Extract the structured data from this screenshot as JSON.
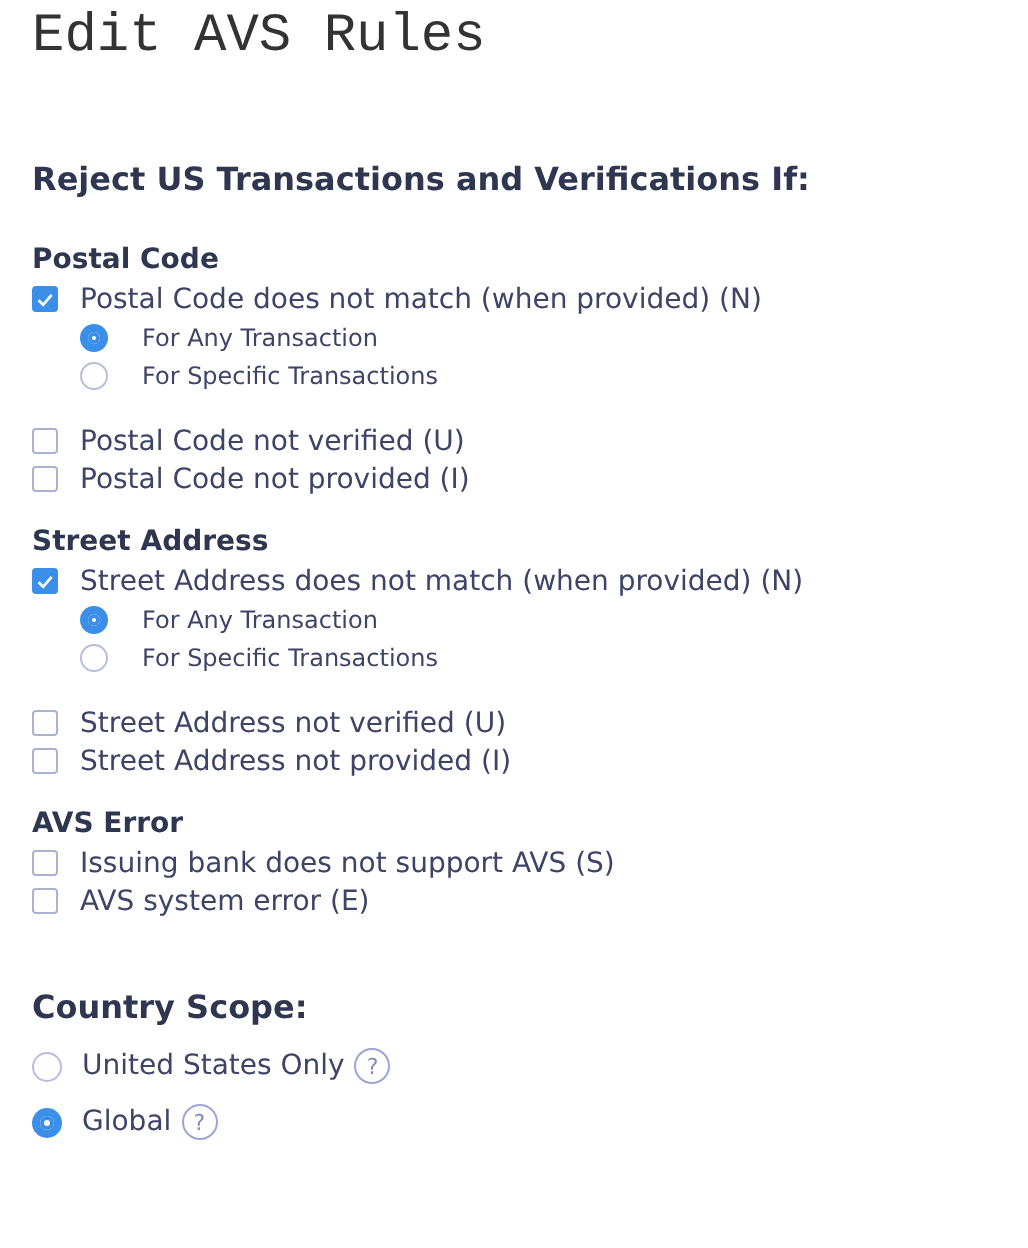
{
  "title": "Edit AVS Rules",
  "heading": "Reject US Transactions and Verifications If:",
  "sections": [
    {
      "title": "Postal Code",
      "options": [
        {
          "label": "Postal Code does not match (when provided) (N)",
          "checked": true,
          "radios": [
            {
              "label": "For Any Transaction",
              "selected": true
            },
            {
              "label": "For Specific Transactions",
              "selected": false
            }
          ]
        },
        {
          "label": "Postal Code not verified (U)",
          "checked": false
        },
        {
          "label": "Postal Code not provided (I)",
          "checked": false
        }
      ]
    },
    {
      "title": "Street Address",
      "options": [
        {
          "label": "Street Address does not match (when provided) (N)",
          "checked": true,
          "radios": [
            {
              "label": "For Any Transaction",
              "selected": true
            },
            {
              "label": "For Specific Transactions",
              "selected": false
            }
          ]
        },
        {
          "label": "Street Address not verified (U)",
          "checked": false
        },
        {
          "label": "Street Address not provided (I)",
          "checked": false
        }
      ]
    },
    {
      "title": "AVS Error",
      "options": [
        {
          "label": "Issuing bank does not support AVS (S)",
          "checked": false
        },
        {
          "label": "AVS system error (E)",
          "checked": false
        }
      ]
    }
  ],
  "country_scope": {
    "title": "Country Scope:",
    "options": [
      {
        "label": "United States Only",
        "selected": false,
        "help": "?"
      },
      {
        "label": "Global",
        "selected": true,
        "help": "?"
      }
    ]
  }
}
